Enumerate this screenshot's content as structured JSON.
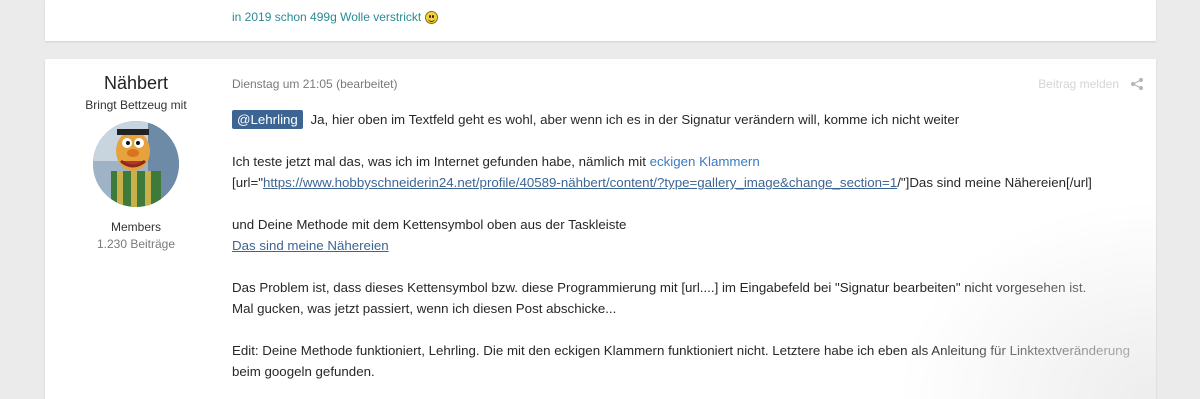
{
  "previous_post": {
    "signature_text": "in 2019 schon 499g Wolle verstrickt",
    "signature_icon": "smiley-icon"
  },
  "author": {
    "name": "Nähbert",
    "title": "Bringt Bettzeug mit",
    "group": "Members",
    "post_count": "1.230 Beiträge"
  },
  "post": {
    "timestamp": "Dienstag um 21:05",
    "edited": "(bearbeitet)",
    "report_label": "Beitrag melden",
    "mention": "@Lehrling",
    "line1": "Ja, hier oben im Textfeld geht es wohl, aber wenn ich es in der Signatur verändern will, komme ich nicht weiter",
    "line2_pre": "Ich teste jetzt mal das, was ich im Internet gefunden habe, nämlich mit ",
    "line2_link": "eckigen Klammern",
    "line3_pre": "[url=\"",
    "line3_link": "https://www.hobbyschneiderin24.net/profile/40589-nähbert/content/?type=gallery_image&change_section=1",
    "line3_post": "/\"]Das sind meine Nähereien[/url]",
    "line4": "und Deine Methode mit dem Kettensymbol oben aus der Taskleiste",
    "line5_link": "Das sind meine Nähereien",
    "line6": "Das Problem ist, dass dieses Kettensymbol bzw. diese Programmierung mit [url....] im Eingabefeld bei \"Signatur bearbeiten\" nicht vorgesehen ist.",
    "line7": "Mal gucken, was jetzt passiert, wenn ich diesen Post abschicke...",
    "line8": "Edit: Deine Methode funktioniert, Lehrling. Die mit den eckigen Klammern funktioniert nicht. Letztere habe ich eben als Anleitung für Linktextveränderung beim googeln gefunden."
  },
  "colors": {
    "signature_teal": "#2a8a96",
    "mention_bg": "#3d6594",
    "link_blue": "#3d7ac1"
  }
}
